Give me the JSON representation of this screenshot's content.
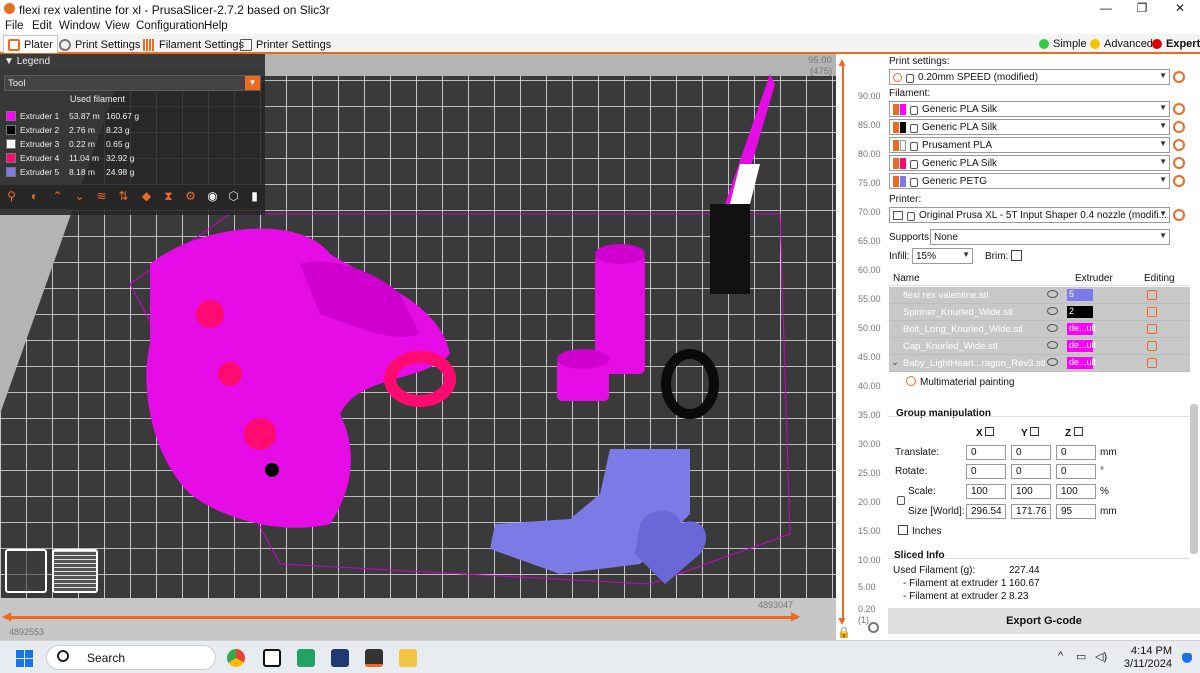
{
  "window": {
    "title": "flexi rex valentine for xl - PrusaSlicer-2.7.2 based on Slic3r",
    "minimize": "—",
    "restore": "❐",
    "close": "✕"
  },
  "menu": [
    "File",
    "Edit",
    "Window",
    "View",
    "Configuration",
    "Help"
  ],
  "tabs": [
    "Plater",
    "Print Settings",
    "Filament Settings",
    "Printer Settings"
  ],
  "modes": [
    {
      "label": "Simple",
      "color": "#2ecc40"
    },
    {
      "label": "Advanced",
      "color": "#f5c400"
    },
    {
      "label": "Expert",
      "color": "#e00000"
    }
  ],
  "legend": {
    "header": "Legend",
    "view_type": "Tool",
    "used_filament_label": "Used filament",
    "extruders": [
      {
        "name": "Extruder 1",
        "length": "53.87 m",
        "weight": "160.67 g",
        "color": "#ff00ff"
      },
      {
        "name": "Extruder 2",
        "length": "2.76 m",
        "weight": "8.23 g",
        "color": "#000000"
      },
      {
        "name": "Extruder 3",
        "length": "0.22 m",
        "weight": "0.65 g",
        "color": "#ffffff"
      },
      {
        "name": "Extruder 4",
        "length": "11.04 m",
        "weight": "32.92 g",
        "color": "#ff0a70"
      },
      {
        "name": "Extruder 5",
        "length": "8.18 m",
        "weight": "24.98 g",
        "color": "#7c7ae6"
      }
    ]
  },
  "ruler": {
    "top_value": "95.00",
    "top_layer": "(475)",
    "ticks": [
      "90.00",
      "85.00",
      "80.00",
      "75.00",
      "70.00",
      "65.00",
      "60.00",
      "55.00",
      "50.00",
      "45.00",
      "40.00",
      "35.00",
      "30.00",
      "25.00",
      "20.00",
      "15.00",
      "10.00",
      "5.00",
      "0.20"
    ],
    "bottom_layer": "(1)"
  },
  "viewport": {
    "hslider_right_value": "4893047",
    "hslider_left_value": "4892553"
  },
  "panel": {
    "print_settings_label": "Print settings:",
    "print_profile": "0.20mm SPEED (modified)",
    "filament_label": "Filament:",
    "filaments": [
      {
        "name": "Generic PLA Silk",
        "swatch": "#ff00ff"
      },
      {
        "name": "Generic PLA Silk",
        "swatch": "#000000"
      },
      {
        "name": "Prusament PLA",
        "swatch": "#ffffff"
      },
      {
        "name": "Generic PLA Silk",
        "swatch": "#ff0a70"
      },
      {
        "name": "Generic PETG",
        "swatch": "#7c7ae6"
      }
    ],
    "printer_label": "Printer:",
    "printer_profile": "Original Prusa XL - 5T Input Shaper 0.4 nozzle (modifi...",
    "supports_label": "Supports:",
    "supports_value": "None",
    "infill_label": "Infill:",
    "infill_value": "15%",
    "brim_label": "Brim:",
    "table_headers": {
      "name": "Name",
      "extruder": "Extruder",
      "editing": "Editing"
    },
    "objects": [
      {
        "name": "flexi rex valentine.stl",
        "extruder": "5",
        "color": "#7c7ae6"
      },
      {
        "name": "Spinner_Knurled_Wide.stl",
        "extruder": "2",
        "color": "#000000"
      },
      {
        "name": "Bolt_Long_Knurled_Wide.stl",
        "extruder": "de...ult",
        "color": "#ff00ff"
      },
      {
        "name": "Cap_Knurled_Wide.stl",
        "extruder": "de...ult",
        "color": "#ff00ff"
      },
      {
        "name": "Baby_LightHeart...ragon_Rev3.stl",
        "extruder": "de...ult",
        "color": "#ff00ff"
      }
    ],
    "mm_painting": "Multimaterial painting",
    "group_title": "Group manipulation",
    "axes": [
      "X",
      "Y",
      "Z"
    ],
    "translate_label": "Translate:",
    "translate": [
      "0",
      "0",
      "0"
    ],
    "translate_unit": "mm",
    "rotate_label": "Rotate:",
    "rotate": [
      "0",
      "0",
      "0"
    ],
    "rotate_unit": "°",
    "scale_label": "Scale:",
    "scale": [
      "100",
      "100",
      "100"
    ],
    "scale_unit": "%",
    "size_label": "Size [World]:",
    "size": [
      "296.54",
      "171.76",
      "95"
    ],
    "size_unit": "mm",
    "inches_label": "Inches",
    "sliced_info_title": "Sliced Info",
    "used_filament_label": "Used Filament (g):",
    "used_filament_value": "227.44",
    "ext1_label": "- Filament at extruder 1",
    "ext1_value": "160.67",
    "ext2_label": "- Filament at extruder 2",
    "ext2_value": "8.23",
    "export_label": "Export G-code"
  },
  "taskbar": {
    "search_placeholder": "Search",
    "time": "4:14 PM",
    "date": "3/11/2024"
  }
}
